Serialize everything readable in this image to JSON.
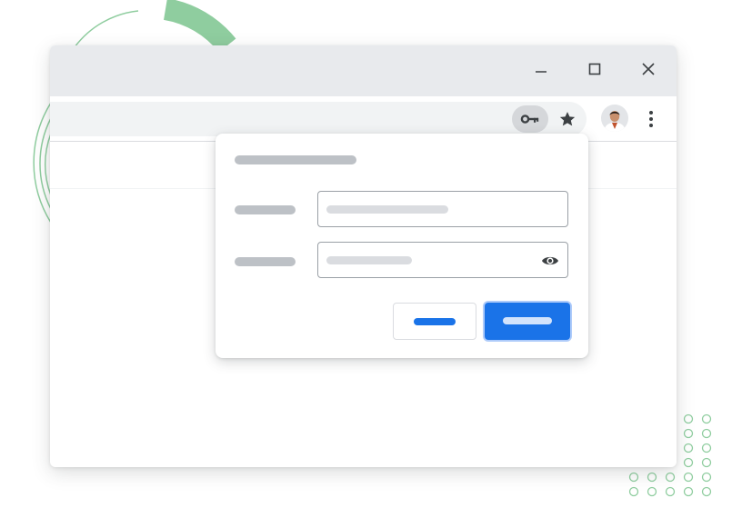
{
  "window": {
    "controls": [
      "minimize-icon",
      "maximize-icon",
      "close-icon"
    ]
  },
  "toolbar": {
    "key_icon": "key-icon",
    "bookmark_icon": "star-icon",
    "avatar": "profile-avatar",
    "menu_icon": "more-vert-icon"
  },
  "dialog": {
    "title": "",
    "username_label": "",
    "username_value": "",
    "password_label": "",
    "password_value": "",
    "reveal_icon": "eye-icon",
    "secondary_button_label": "",
    "primary_button_label": ""
  },
  "colors": {
    "accent_blue": "#1a73e8",
    "decor_green": "#34a853",
    "placeholder_gray": "#bdc1c6",
    "chrome_frame": "#e8eaed"
  }
}
